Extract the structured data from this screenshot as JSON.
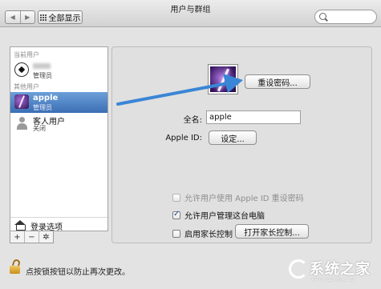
{
  "window": {
    "title": "用户与群组",
    "back_arrow": "◀",
    "forward_arrow": "▶",
    "show_all_label": "全部显示"
  },
  "sidebar": {
    "current_users_label": "当前用户",
    "other_users_label": "其他用户",
    "current_user": {
      "name": "",
      "role": "管理员"
    },
    "other_users": [
      {
        "name": "apple",
        "role": "管理员",
        "selected": true
      },
      {
        "name": "客人用户",
        "role": "关闭",
        "selected": false
      }
    ],
    "login_options_label": "登录选项",
    "toolbar": {
      "add": "+",
      "remove": "−",
      "gear": "✲"
    }
  },
  "main": {
    "reset_password_button": "重设密码...",
    "full_name_label": "全名:",
    "full_name_value": "apple",
    "apple_id_label": "Apple ID:",
    "apple_id_button": "设定...",
    "checkboxes": [
      {
        "label": "允许用户使用 Apple ID 重设密码",
        "checked": false,
        "disabled": true
      },
      {
        "label": "允许用户管理这台电脑",
        "checked": true,
        "disabled": false
      },
      {
        "label": "启用家长控制",
        "checked": false,
        "disabled": false
      }
    ],
    "parental_controls_button": "打开家长控制..."
  },
  "footer": {
    "lock_text": "点按锁按钮以防止再次更改。"
  },
  "watermark": {
    "text": "系统之家",
    "url": "XITONGZHIJIA.NET"
  },
  "colors": {
    "selection": "#3b6fb5",
    "arrow": "#3a86d6",
    "lock": "#c98f1e"
  }
}
